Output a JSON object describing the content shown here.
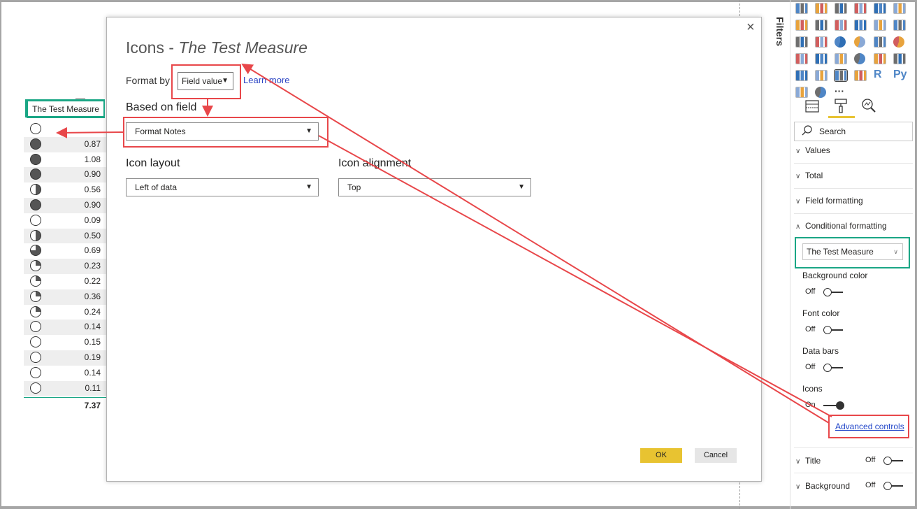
{
  "table_visual": {
    "header": "The Test Measure",
    "rows": [
      {
        "icon": "empty",
        "value": ""
      },
      {
        "icon": "full",
        "value": "0.87"
      },
      {
        "icon": "full",
        "value": "1.08"
      },
      {
        "icon": "full",
        "value": "0.90"
      },
      {
        "icon": "half",
        "value": "0.56"
      },
      {
        "icon": "full",
        "value": "0.90"
      },
      {
        "icon": "empty",
        "value": "0.09"
      },
      {
        "icon": "half",
        "value": "0.50"
      },
      {
        "icon": "three-quarter",
        "value": "0.69"
      },
      {
        "icon": "quarter",
        "value": "0.23"
      },
      {
        "icon": "quarter",
        "value": "0.22"
      },
      {
        "icon": "quarter",
        "value": "0.36"
      },
      {
        "icon": "quarter",
        "value": "0.24"
      },
      {
        "icon": "empty",
        "value": "0.14"
      },
      {
        "icon": "empty",
        "value": "0.15"
      },
      {
        "icon": "empty",
        "value": "0.19"
      },
      {
        "icon": "empty",
        "value": "0.14"
      },
      {
        "icon": "empty",
        "value": "0.11"
      }
    ],
    "total": "7.37"
  },
  "dialog": {
    "title_plain": "Icons - ",
    "title_italic": "The Test Measure",
    "close_glyph": "×",
    "format_by_label": "Format by",
    "format_by_value": "Field value",
    "learn_more": "Learn more",
    "based_on_label": "Based on field",
    "based_on_value": "Format Notes",
    "icon_layout_label": "Icon layout",
    "icon_layout_value": "Left of data",
    "icon_alignment_label": "Icon alignment",
    "icon_alignment_value": "Top",
    "ok": "OK",
    "cancel": "Cancel"
  },
  "filters": {
    "label": "Filters"
  },
  "viz_pane": {
    "more": "···",
    "r_label": "R",
    "py_label": "Py",
    "search_placeholder": "Search",
    "sections": {
      "values": "Values",
      "total": "Total",
      "field_formatting": "Field formatting",
      "conditional_formatting": "Conditional formatting",
      "title": "Title",
      "background": "Background"
    },
    "cf_field": "The Test Measure",
    "options": [
      {
        "label": "Background color",
        "state": "Off"
      },
      {
        "label": "Font color",
        "state": "Off"
      },
      {
        "label": "Data bars",
        "state": "Off"
      },
      {
        "label": "Icons",
        "state": "On"
      }
    ],
    "advanced_controls": "Advanced controls",
    "title_state": "Off",
    "background_state": "Off"
  },
  "colors": {
    "annotation_red": "#e8474a",
    "annotation_green": "#1aa685",
    "ok_button": "#e8c331",
    "link_blue": "#1f44c8"
  }
}
